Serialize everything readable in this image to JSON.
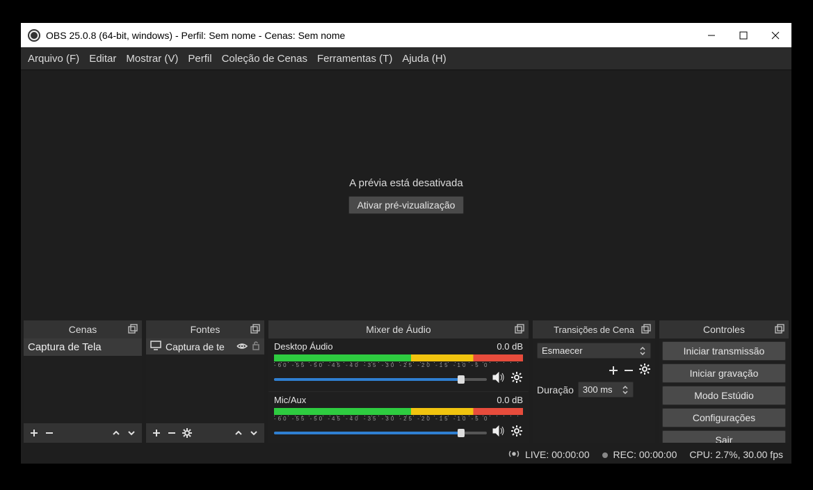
{
  "window": {
    "title": "OBS 25.0.8 (64-bit, windows) - Perfil: Sem nome - Cenas: Sem nome"
  },
  "menu": {
    "arquivo": "Arquivo (F)",
    "editar": "Editar",
    "mostrar": "Mostrar (V)",
    "perfil": "Perfil",
    "colecao": "Coleção de Cenas",
    "ferramentas": "Ferramentas (T)",
    "ajuda": "Ajuda (H)"
  },
  "preview": {
    "disabled_text": "A prévia está desativada",
    "enable_button": "Ativar pré-vizualização"
  },
  "docks": {
    "scenes": {
      "title": "Cenas",
      "items": [
        "Captura de Tela"
      ]
    },
    "sources": {
      "title": "Fontes",
      "items": [
        "Captura de te"
      ]
    },
    "mixer": {
      "title": "Mixer de Áudio",
      "channels": [
        {
          "name": "Desktop Áudio",
          "db": "0.0 dB"
        },
        {
          "name": "Mic/Aux",
          "db": "0.0 dB"
        }
      ],
      "ticks": "-60  -55  -50  -45  -40  -35  -30  -25  -20  -15  -10  -5  0"
    },
    "transitions": {
      "title": "Transições de Cena",
      "selected": "Esmaecer",
      "duration_label": "Duração",
      "duration_value": "300 ms"
    },
    "controls": {
      "title": "Controles",
      "buttons": {
        "start_stream": "Iniciar transmissão",
        "start_record": "Iniciar gravação",
        "studio_mode": "Modo Estúdio",
        "settings": "Configurações",
        "exit": "Sair"
      }
    }
  },
  "status": {
    "live": "LIVE: 00:00:00",
    "rec": "REC: 00:00:00",
    "cpu": "CPU: 2.7%, 30.00 fps"
  }
}
